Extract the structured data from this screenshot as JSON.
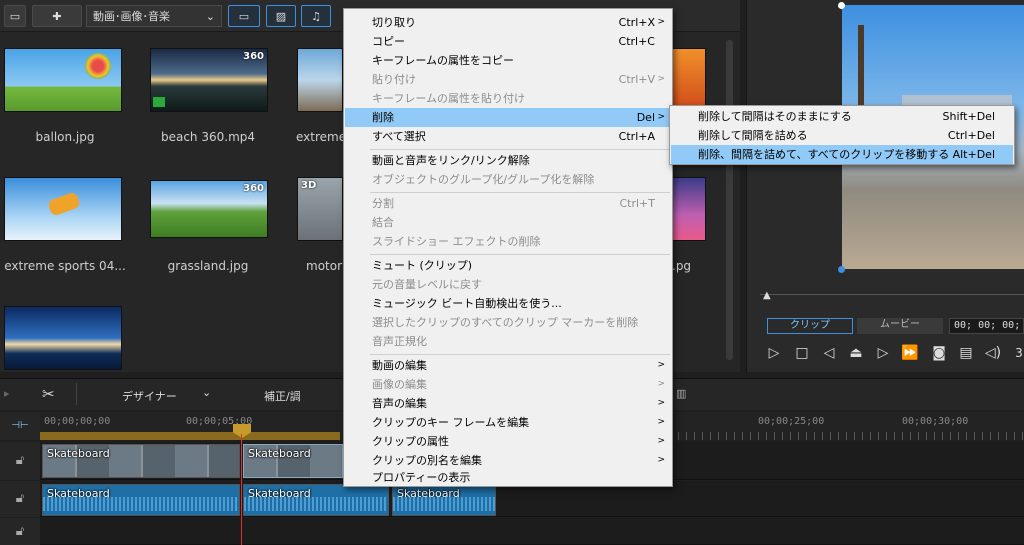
{
  "library": {
    "filter_label": "動画･画像･音楽",
    "items": [
      {
        "label": "ballon.jpg",
        "badge": ""
      },
      {
        "label": "beach 360.mp4",
        "badge": "360"
      },
      {
        "label": "extreme",
        "badge": ""
      },
      {
        "label": "extreme sports 04...",
        "badge": ""
      },
      {
        "label": "grassland.jpg",
        "badge": "360"
      },
      {
        "label": "motor",
        "badge": "3D"
      },
      {
        "label": "",
        "badge": ""
      },
      {
        "label": ".pg",
        "badge": ""
      }
    ]
  },
  "preview": {
    "tab_clip": "クリップ",
    "tab_movie": "ムービー",
    "timecode": "00; 00; 00; 0",
    "partial_digit": "3"
  },
  "timeline": {
    "designer_label": "デザイナー",
    "correction_label": "補正/調",
    "ruler": [
      "00;00;00;00",
      "00;00;05;00",
      "00;00;25;00",
      "00;00;30;00"
    ],
    "clips": [
      "Skateboard",
      "Skateboard",
      "Skateboard",
      "Skateboard",
      "Skateboard"
    ]
  },
  "context_menu": {
    "items": [
      {
        "label": "切り取り",
        "shortcut": "Ctrl+X"
      },
      {
        "label": "コピー",
        "shortcut": "Ctrl+C"
      },
      {
        "label": "キーフレームの属性をコピー",
        "shortcut": ""
      },
      {
        "label": "貼り付け",
        "shortcut": "Ctrl+V"
      },
      {
        "label": "キーフレームの属性を貼り付け",
        "shortcut": ""
      },
      {
        "label": "削除",
        "shortcut": "Del"
      },
      {
        "label": "すべて選択",
        "shortcut": "Ctrl+A"
      },
      {
        "label": "動画と音声をリンク/リンク解除",
        "shortcut": ""
      },
      {
        "label": "オブジェクトのグループ化/グループ化を解除",
        "shortcut": ""
      },
      {
        "label": "分割",
        "shortcut": "Ctrl+T"
      },
      {
        "label": "結合",
        "shortcut": ""
      },
      {
        "label": "スライドショー エフェクトの削除",
        "shortcut": ""
      },
      {
        "label": "ミュート (クリップ)",
        "shortcut": ""
      },
      {
        "label": "元の音量レベルに戻す",
        "shortcut": ""
      },
      {
        "label": "ミュージック ビート自動検出を使う...",
        "shortcut": ""
      },
      {
        "label": "選択したクリップのすべてのクリップ マーカーを削除",
        "shortcut": ""
      },
      {
        "label": "音声正規化",
        "shortcut": ""
      },
      {
        "label": "動画の編集",
        "shortcut": ""
      },
      {
        "label": "画像の編集",
        "shortcut": ""
      },
      {
        "label": "音声の編集",
        "shortcut": ""
      },
      {
        "label": "クリップのキー フレームを編集",
        "shortcut": ""
      },
      {
        "label": "クリップの属性",
        "shortcut": ""
      },
      {
        "label": "クリップの別名を編集",
        "shortcut": ""
      },
      {
        "label": "プロパティーの表示",
        "shortcut": ""
      }
    ]
  },
  "submenu": {
    "items": [
      {
        "label": "削除して間隔はそのままにする",
        "shortcut": "Shift+Del"
      },
      {
        "label": "削除して間隔を詰める",
        "shortcut": "Ctrl+Del"
      },
      {
        "label": "削除、間隔を詰めて、すべてのクリップを移動する",
        "shortcut": "Alt+Del"
      }
    ]
  },
  "colors": {
    "accent": "#91c9f7",
    "menu_bg": "#f0f0f0",
    "app_bg": "#1f1f1f"
  }
}
